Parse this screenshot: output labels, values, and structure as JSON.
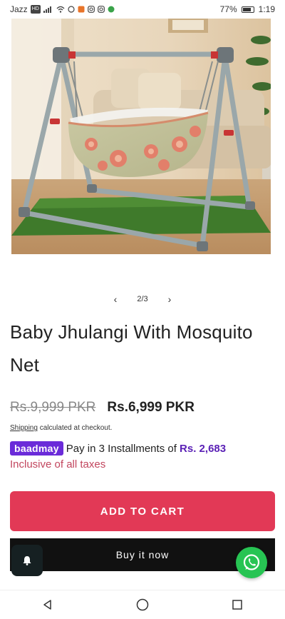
{
  "status_bar": {
    "carrier": "Jazz",
    "network_badge": "HD",
    "battery": "77%",
    "time": "1:19",
    "icons": [
      "signal-icon",
      "wifi-icon",
      "whatsapp-icon",
      "notification-icon",
      "instagram-icon",
      "instagram-icon",
      "app-icon"
    ]
  },
  "gallery": {
    "pager": "2/3",
    "prev_icon": "chevron-left-icon",
    "next_icon": "chevron-right-icon"
  },
  "product": {
    "title": "Baby Jhulangi With Mosquito Net",
    "price_old": "Rs.9,999 PKR",
    "price_new": "Rs.6,999 PKR",
    "shipping_link": "Shipping",
    "shipping_text": " calculated at checkout.",
    "baadmay_logo": "baadmay",
    "installments_text": "Pay in 3 Installments of ",
    "installment_amount": "Rs. 2,683",
    "tax_note": "Inclusive of all taxes"
  },
  "actions": {
    "add_to_cart": "ADD TO CART",
    "buy_now": "Buy it now"
  },
  "colors": {
    "add_to_cart_bg": "#e23956",
    "buy_now_bg": "#111111",
    "baadmay_purple": "#6b2bd9",
    "tax_text": "#c2465e",
    "whatsapp_green": "#27c453"
  },
  "fabs": {
    "notification": "bell-icon",
    "whatsapp": "whatsapp-icon"
  },
  "nav": [
    "back-icon",
    "home-icon",
    "recents-icon"
  ]
}
